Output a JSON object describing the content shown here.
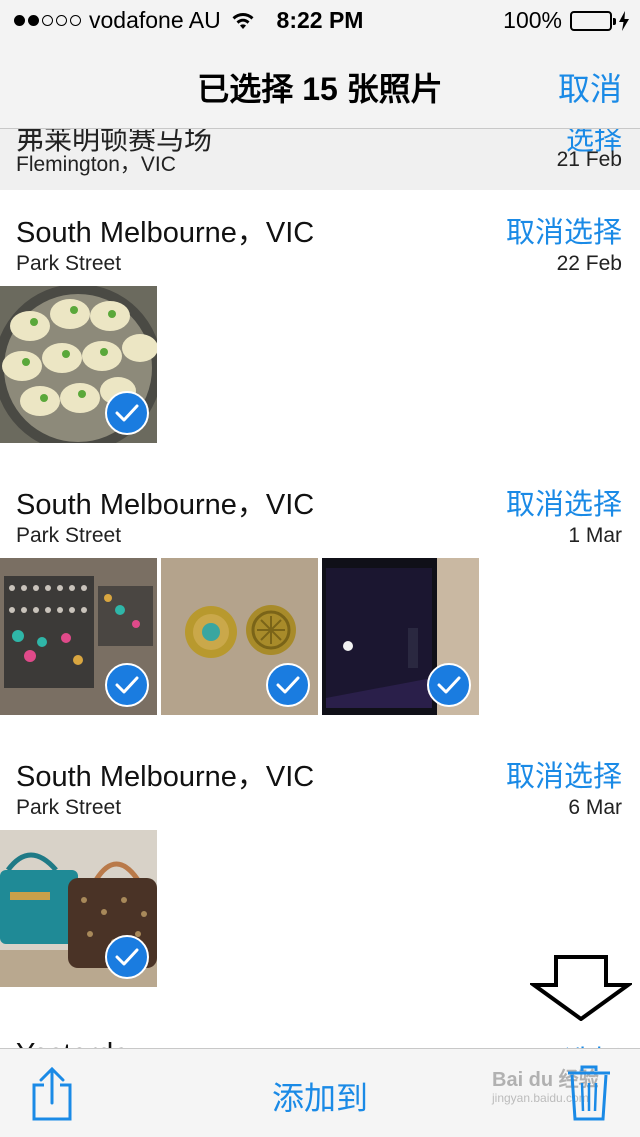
{
  "status_bar": {
    "carrier": "vodafone AU",
    "time": "8:22 PM",
    "battery": "100%"
  },
  "nav": {
    "title": "已选择 15 张照片",
    "cancel_label": "取消"
  },
  "partial_section": {
    "title_cut": "弗莱明顿赛马场",
    "action_cut": "选择",
    "subtitle": "Flemington，VIC",
    "date": "21 Feb"
  },
  "sections": [
    {
      "title": "South Melbourne，VIC",
      "subtitle": "Park Street",
      "action": "取消选择",
      "date": "22 Feb",
      "photo_count": 1
    },
    {
      "title": "South Melbourne，VIC",
      "subtitle": "Park Street",
      "action": "取消选择",
      "date": "1 Mar",
      "photo_count": 3
    },
    {
      "title": "South Melbourne，VIC",
      "subtitle": "Park Street",
      "action": "取消选择",
      "date": "6 Mar",
      "photo_count": 1
    }
  ],
  "bottom_partial": {
    "title_cut": "Yesterday",
    "action_cut": "选择"
  },
  "toolbar": {
    "add_to_label": "添加到"
  },
  "watermark": {
    "text": "Bai du 经验",
    "sub": "jingyan.baidu.com"
  },
  "colors": {
    "accent": "#1a8ae6",
    "checkmark": "#1a7ce0",
    "battery": "#4cd964"
  },
  "icons": [
    "wifi-icon",
    "battery-icon",
    "charging-bolt-icon",
    "checkmark-icon",
    "share-icon",
    "trash-icon",
    "down-arrow-icon"
  ]
}
